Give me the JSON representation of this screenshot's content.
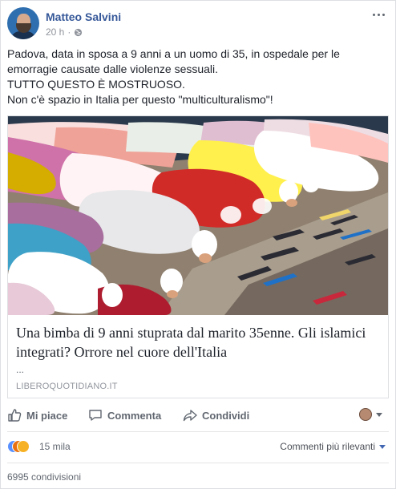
{
  "post": {
    "author": "Matteo Salvini",
    "time": "20 h",
    "separator": "·",
    "text_lines": [
      "Padova, data in sposa a 9 anni a un uomo di 35, in ospedale per le",
      "emorragie causate dalle violenze sessuali.",
      "TUTTO QUESTO È MOSTRUOSO.",
      "Non c'è spazio in Italia per questo \"multiculturalismo\"!"
    ]
  },
  "link": {
    "title": "Una bimba di 9 anni stuprata dal marito 35enne. Gli islamici integrati? Orrore nel cuore dell'Italia",
    "description": "...",
    "domain": "LIBEROQUOTIDIANO.IT"
  },
  "actions": {
    "like": "Mi piace",
    "comment": "Commenta",
    "share": "Condividi"
  },
  "stats": {
    "reactions_count": "15 mila",
    "comments_order": "Commenti più rilevanti",
    "shares": "6995 condivisioni"
  },
  "icons": {
    "globe": "globe-icon",
    "more": "more-options-icon",
    "like": "thumbs-up-icon",
    "comment": "comment-bubble-icon",
    "share": "share-arrow-icon",
    "reactions": [
      "like-reaction-icon",
      "angry-reaction-icon",
      "sad-reaction-icon"
    ]
  },
  "colors": {
    "author": "#365899",
    "secondary": "#90949c",
    "action": "#616770",
    "like_reaction": "#5890ff"
  }
}
